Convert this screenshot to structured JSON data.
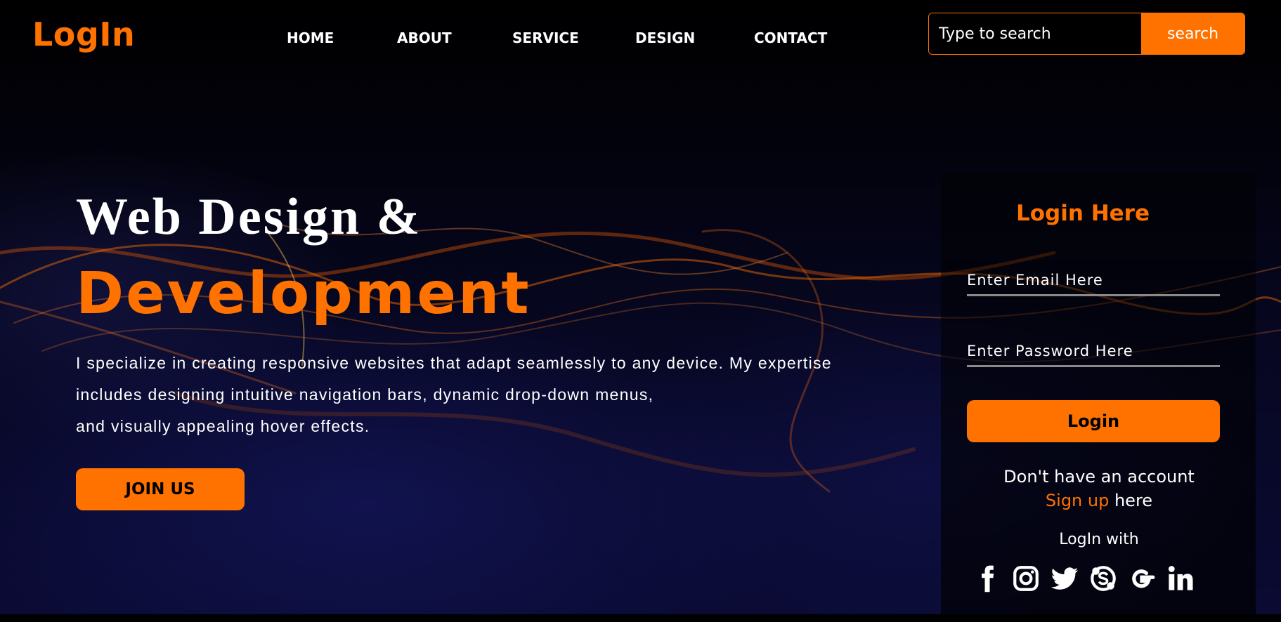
{
  "header": {
    "brand": "LogIn",
    "nav": [
      "HOME",
      "ABOUT",
      "SERVICE",
      "DESIGN",
      "CONTACT"
    ],
    "search": {
      "placeholder": "Type to search",
      "button_label": "search"
    }
  },
  "hero": {
    "title_line1": "Web Design &",
    "title_line2": "Development",
    "description_lines": [
      "I specialize in creating responsive websites that adapt seamlessly to any device. My expertise",
      "includes designing intuitive navigation bars, dynamic drop-down menus,",
      "and visually appealing hover effects."
    ],
    "cta_label": "JOIN US"
  },
  "login": {
    "title": "Login Here",
    "email_placeholder": "Enter Email Here",
    "password_placeholder": "Enter Password Here",
    "button_label": "Login",
    "no_account_text": "Don't have an account",
    "signup_link": "Sign up",
    "signup_suffix": " here",
    "login_with_text": "LogIn with",
    "social_icons": [
      "facebook-icon",
      "instagram-icon",
      "twitter-icon",
      "skype-icon",
      "google-icon",
      "linkedin-icon"
    ]
  },
  "colors": {
    "accent": "#ff7200",
    "background": "#000000",
    "text": "#ffffff"
  }
}
